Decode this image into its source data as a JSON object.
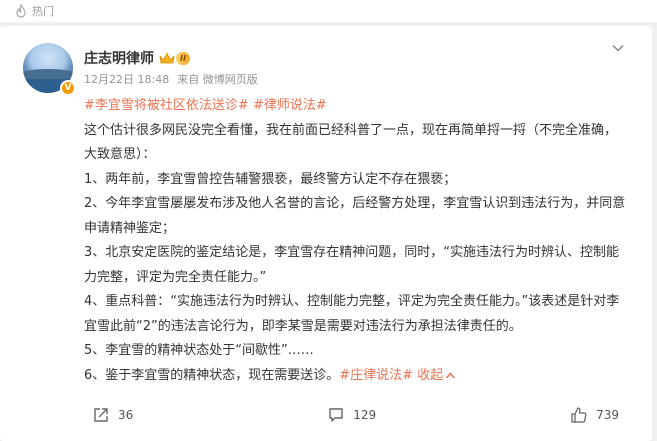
{
  "header": {
    "section_label": "热门"
  },
  "post": {
    "author": "庄志明律师",
    "member_level": "II",
    "verified_badge": "V",
    "date": "12月22日 18:48",
    "source": "来自 微博网页版",
    "topics": [
      "#李宜雪将被社区依法送诊#",
      "#律师说法#"
    ],
    "lines": [
      "这个估计很多网民没完全看懂，我在前面已经科普了一点，现在再简单捋一捋（不完全准确，大致意思）：",
      "1、两年前，李宜雪曾控告辅警猥亵，最终警方认定不存在猥亵；",
      "2、今年李宜雪屡屡发布涉及他人名誉的言论，后经警方处理，李宜雪认识到违法行为，并同意申请精神鉴定；",
      "3、北京安定医院的鉴定结论是，李宜雪存在精神问题，同时，“实施违法行为时辨认、控制能力完整，评定为完全责任能力。”",
      "4、重点科普：“实施违法行为时辨认、控制能力完整，评定为完全责任能力。”该表述是针对李宜雪此前“2”的违法言论行为，即李某雪是需要对违法行为承担法律责任的。",
      "5、李宜雪的精神状态处于“间歇性”……"
    ],
    "last_line": "6、鉴于李宜雪的精神状态，现在需要送诊。",
    "last_tag": "#庄律说法#",
    "collapse_label": "收起"
  },
  "actions": {
    "share_count": "36",
    "comment_count": "129",
    "like_count": "739"
  },
  "colors": {
    "accent": "#eb7350",
    "text": "#333333",
    "meta": "#939393",
    "background": "#eef0f2"
  },
  "icons": [
    "fire-icon",
    "avatar",
    "verified-badge",
    "crown-icon",
    "chevron-down-icon",
    "share-icon",
    "comment-icon",
    "like-icon"
  ]
}
